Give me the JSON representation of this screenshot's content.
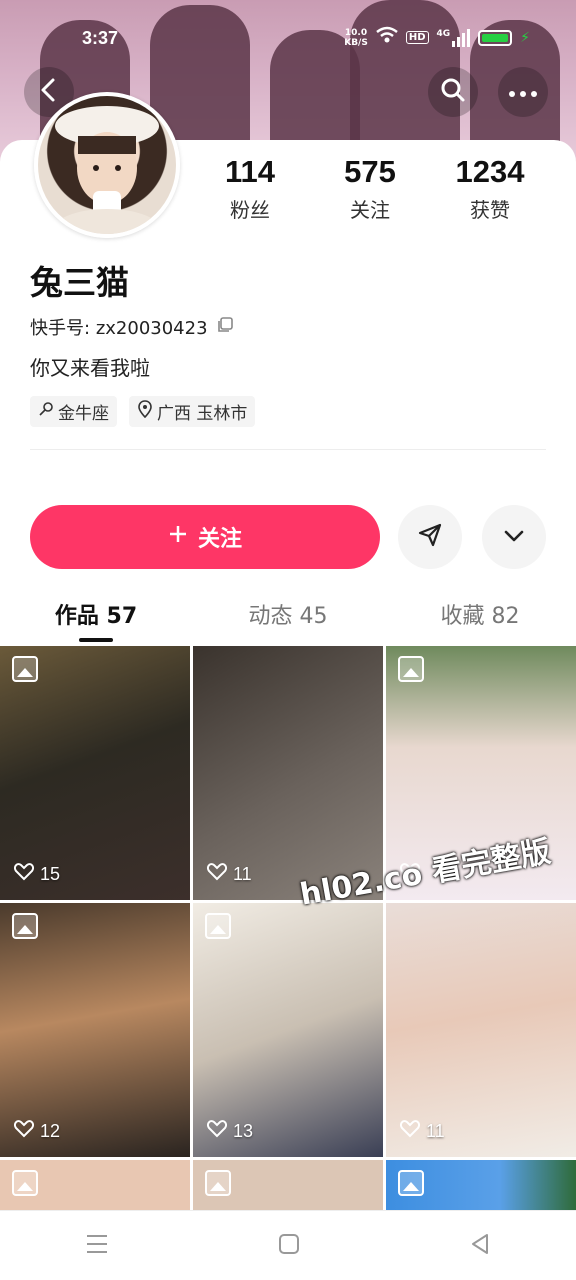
{
  "status_bar": {
    "time": "3:37",
    "net_speed_value": "10.0",
    "net_speed_unit": "KB/S",
    "hd_label": "HD",
    "network_label": "4G"
  },
  "profile": {
    "name": "兔三猫",
    "id_label": "快手号:",
    "id_value": "zx20030423",
    "bio": "你又来看我啦",
    "tags": [
      "金牛座",
      "广西 玉林市"
    ]
  },
  "stats": [
    {
      "value": "114",
      "label": "粉丝"
    },
    {
      "value": "575",
      "label": "关注"
    },
    {
      "value": "1234",
      "label": "获赞"
    }
  ],
  "actions": {
    "follow_label": "关注"
  },
  "tabs": [
    {
      "label": "作品 57",
      "active": true
    },
    {
      "label": "动态 45",
      "active": false
    },
    {
      "label": "收藏 82",
      "active": false
    }
  ],
  "posts": [
    {
      "likes": "15"
    },
    {
      "likes": "11"
    },
    {
      "likes": ""
    },
    {
      "likes": "12"
    },
    {
      "likes": "13"
    },
    {
      "likes": "11"
    }
  ],
  "watermark": "hl02.co 看完整版",
  "colors": {
    "accent": "#fe3666",
    "battery": "#27d043"
  },
  "icons": [
    "back-icon",
    "search-icon",
    "more-icon",
    "copy-icon",
    "constellation-icon",
    "location-icon",
    "plus-icon",
    "share-icon",
    "chevron-down-icon",
    "image-icon",
    "heart-icon",
    "menu-icon",
    "home-icon",
    "back-nav-icon"
  ]
}
